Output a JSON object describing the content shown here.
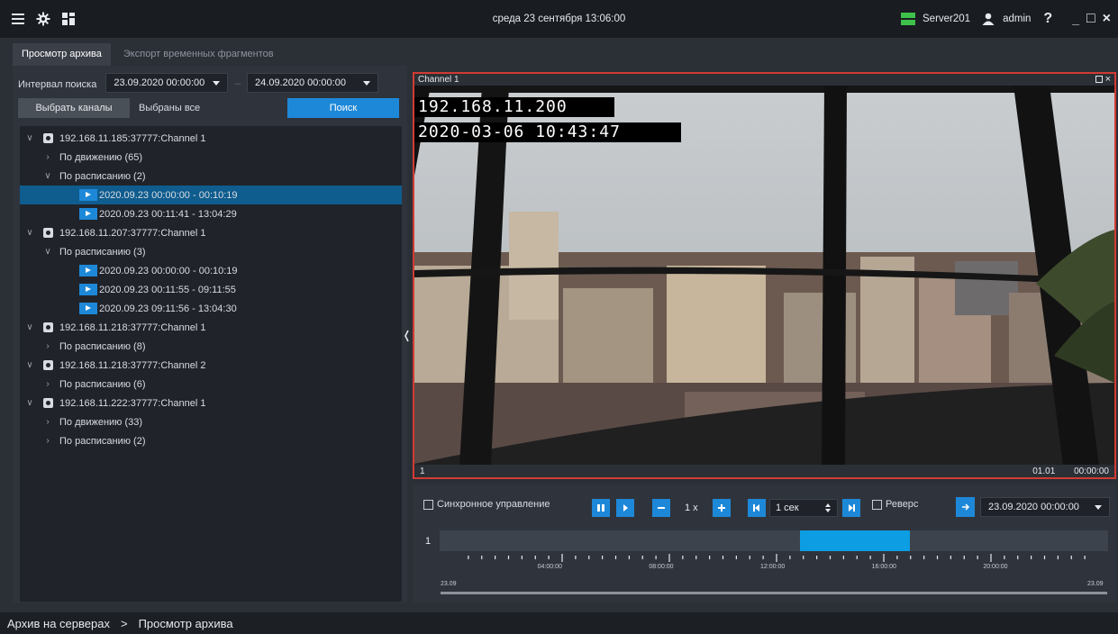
{
  "topbar": {
    "title": "среда 23 сентября 13:06:00",
    "server": "Server201",
    "user": "admin",
    "help": "?",
    "minimize": "_",
    "maximize": "□",
    "close": "×"
  },
  "tabs": [
    {
      "label": "Просмотр архива",
      "active": true
    },
    {
      "label": "Экспорт временных фрагментов",
      "active": false
    }
  ],
  "search": {
    "interval_label": "Интервал поиска",
    "from": "23.09.2020  00:00:00",
    "separator": "–",
    "to": "24.09.2020  00:00:00",
    "select_channels": "Выбрать каналы",
    "selected_all": "Выбраны все",
    "search_button": "Поиск"
  },
  "tree": [
    {
      "type": "camera",
      "label": "192.168.11.185:37777:Channel 1",
      "expanded": true
    },
    {
      "type": "group",
      "label": "По движению (65)",
      "expanded": false
    },
    {
      "type": "group",
      "label": "По расписанию (2)",
      "expanded": true
    },
    {
      "type": "record",
      "label": "2020.09.23  00:00:00 - 00:10:19",
      "selected": true
    },
    {
      "type": "record",
      "label": "2020.09.23  00:11:41 - 13:04:29"
    },
    {
      "type": "camera",
      "label": "192.168.11.207:37777:Channel 1",
      "expanded": true
    },
    {
      "type": "group",
      "label": "По расписанию (3)",
      "expanded": true
    },
    {
      "type": "record",
      "label": "2020.09.23  00:00:00 - 00:10:19"
    },
    {
      "type": "record",
      "label": "2020.09.23  00:11:55 - 09:11:55"
    },
    {
      "type": "record",
      "label": "2020.09.23  09:11:56 - 13:04:30"
    },
    {
      "type": "camera",
      "label": "192.168.11.218:37777:Channel 1",
      "expanded": true
    },
    {
      "type": "group",
      "label": "По расписанию (8)",
      "expanded": false
    },
    {
      "type": "camera",
      "label": "192.168.11.218:37777:Channel 2",
      "expanded": true
    },
    {
      "type": "group",
      "label": "По расписанию (6)",
      "expanded": false
    },
    {
      "type": "camera",
      "label": "192.168.11.222:37777:Channel 1",
      "expanded": true
    },
    {
      "type": "group",
      "label": "По движению (33)",
      "expanded": false
    },
    {
      "type": "group",
      "label": "По расписанию (2)",
      "expanded": false
    }
  ],
  "video": {
    "channel": "Channel 1",
    "osd_ip": "192.168.11.200",
    "osd_time": "2020-03-06 10:43:47",
    "footer_index": "1",
    "footer_date": "01.01",
    "footer_time": "00:00:00"
  },
  "controls": {
    "sync_label": "Синхронное управление",
    "speed": "1 x",
    "step": "1 сек",
    "reverse_label": "Реверс",
    "goto_datetime": "23.09.2020  00:00:00",
    "track_label": "1",
    "timeline_hours": [
      "04:00:00",
      "08:00:00",
      "12:00:00",
      "16:00:00",
      "20:00:00"
    ],
    "date_left": "23.09",
    "date_right": "23.09",
    "selection_start_hour": 12.95,
    "selection_end_hour": 16.9
  },
  "statusbar": {
    "crumb1": "Архив на серверах",
    "sep": ">",
    "crumb2": "Просмотр архива"
  },
  "colors": {
    "accent": "#1e88d8",
    "timeline_fill": "#0c9de3",
    "selection": "#0f5c8e",
    "video_border": "#d23a34",
    "server_ok": "#3ec14a"
  }
}
